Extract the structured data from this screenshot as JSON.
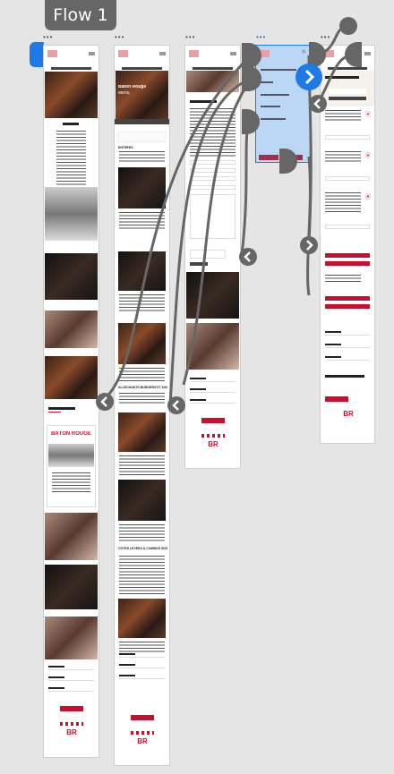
{
  "flow": {
    "label": "Flow 1"
  },
  "frames": {
    "menu": {
      "hero_title": "Bâton Rouge",
      "hero_subtitle": "Menu",
      "sections": [
        "ENTRÉES",
        "ALLÉCHANTS BURGERS ET SANDWICHS",
        "CÔTES LEVÉES & COMBOS SIGNATURE"
      ]
    },
    "home": {
      "card_sign": "BÂTON ROUGE"
    },
    "logo": "BR"
  },
  "colors": {
    "brand_red": "#c8102e",
    "selection_blue": "#1e7be5",
    "connector_gray": "#666666"
  }
}
